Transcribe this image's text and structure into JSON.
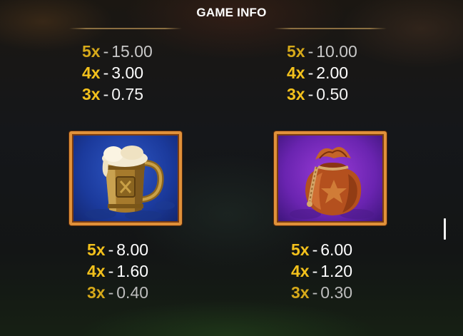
{
  "header": {
    "title": "GAME INFO"
  },
  "paytable": [
    {
      "symbol": "top-left-symbol",
      "rows": [
        {
          "mult": "5x",
          "value": "15.00"
        },
        {
          "mult": "4x",
          "value": "3.00"
        },
        {
          "mult": "3x",
          "value": "0.75"
        }
      ]
    },
    {
      "symbol": "top-right-symbol",
      "rows": [
        {
          "mult": "5x",
          "value": "10.00"
        },
        {
          "mult": "4x",
          "value": "2.00"
        },
        {
          "mult": "3x",
          "value": "0.50"
        }
      ]
    },
    {
      "symbol": "beer-mug",
      "rows": [
        {
          "mult": "5x",
          "value": "8.00"
        },
        {
          "mult": "4x",
          "value": "1.60"
        },
        {
          "mult": "3x",
          "value": "0.40"
        }
      ]
    },
    {
      "symbol": "coin-bag",
      "rows": [
        {
          "mult": "5x",
          "value": "6.00"
        },
        {
          "mult": "4x",
          "value": "1.20"
        },
        {
          "mult": "3x",
          "value": "0.30"
        }
      ]
    }
  ],
  "separator": "-",
  "symbols": {
    "beer_mug": {
      "icon": "beer-mug-icon",
      "frame_color": "#e0913a",
      "bg_color": "#1b3a9c"
    },
    "coin_bag": {
      "icon": "coin-bag-icon",
      "frame_color": "#e0913a",
      "bg_color": "#6a24b0"
    }
  },
  "colors": {
    "multiplier": "#f3c11c",
    "value": "#ffffff",
    "title": "#ffffff"
  }
}
